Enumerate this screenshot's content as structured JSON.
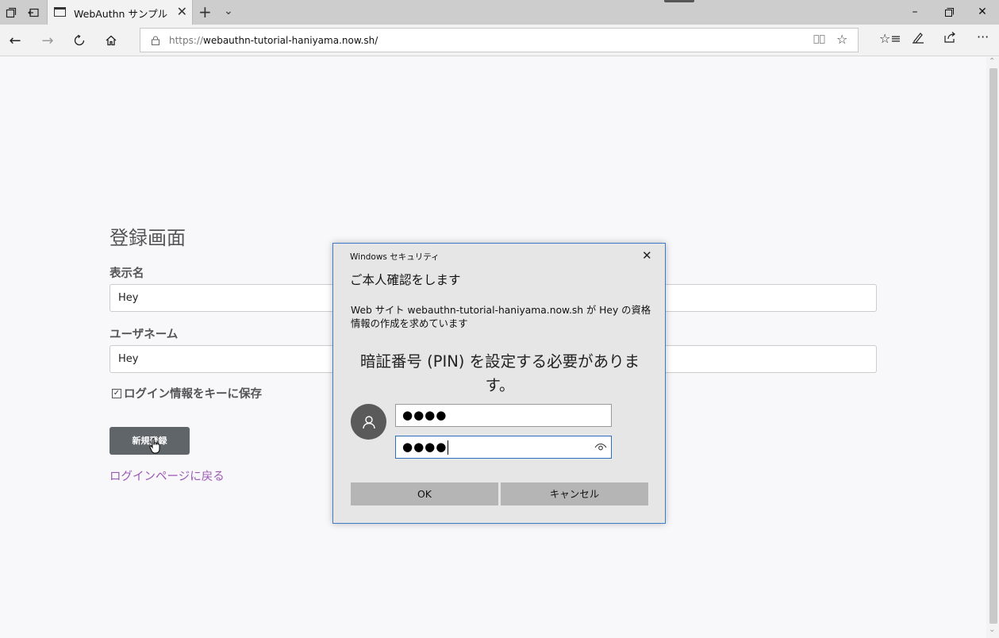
{
  "browser": {
    "tab_title": "WebAuthn サンプル",
    "url_scheme": "https://",
    "url_host": "webauthn-tutorial-haniyama.now.sh/"
  },
  "form": {
    "title": "登録画面",
    "display_name_label": "表示名",
    "display_name_value": "Hey",
    "username_label": "ユーザネーム",
    "username_value": "Hey",
    "save_checkbox_label": "ログイン情報をキーに保存",
    "register_button": "新規登録",
    "back_link": "ログインページに戻る"
  },
  "dialog": {
    "app_name": "Windows セキュリティ",
    "title": "ご本人確認をします",
    "description": "Web サイト webauthn-tutorial-haniyama.now.sh が Hey の資格情報の作成を求めています",
    "pin_message": "暗証番号 (PIN) を設定する必要があります。",
    "pin_value": "●●●●",
    "confirm_pin_value": "●●●●",
    "ok_button": "OK",
    "cancel_button": "キャンセル"
  }
}
